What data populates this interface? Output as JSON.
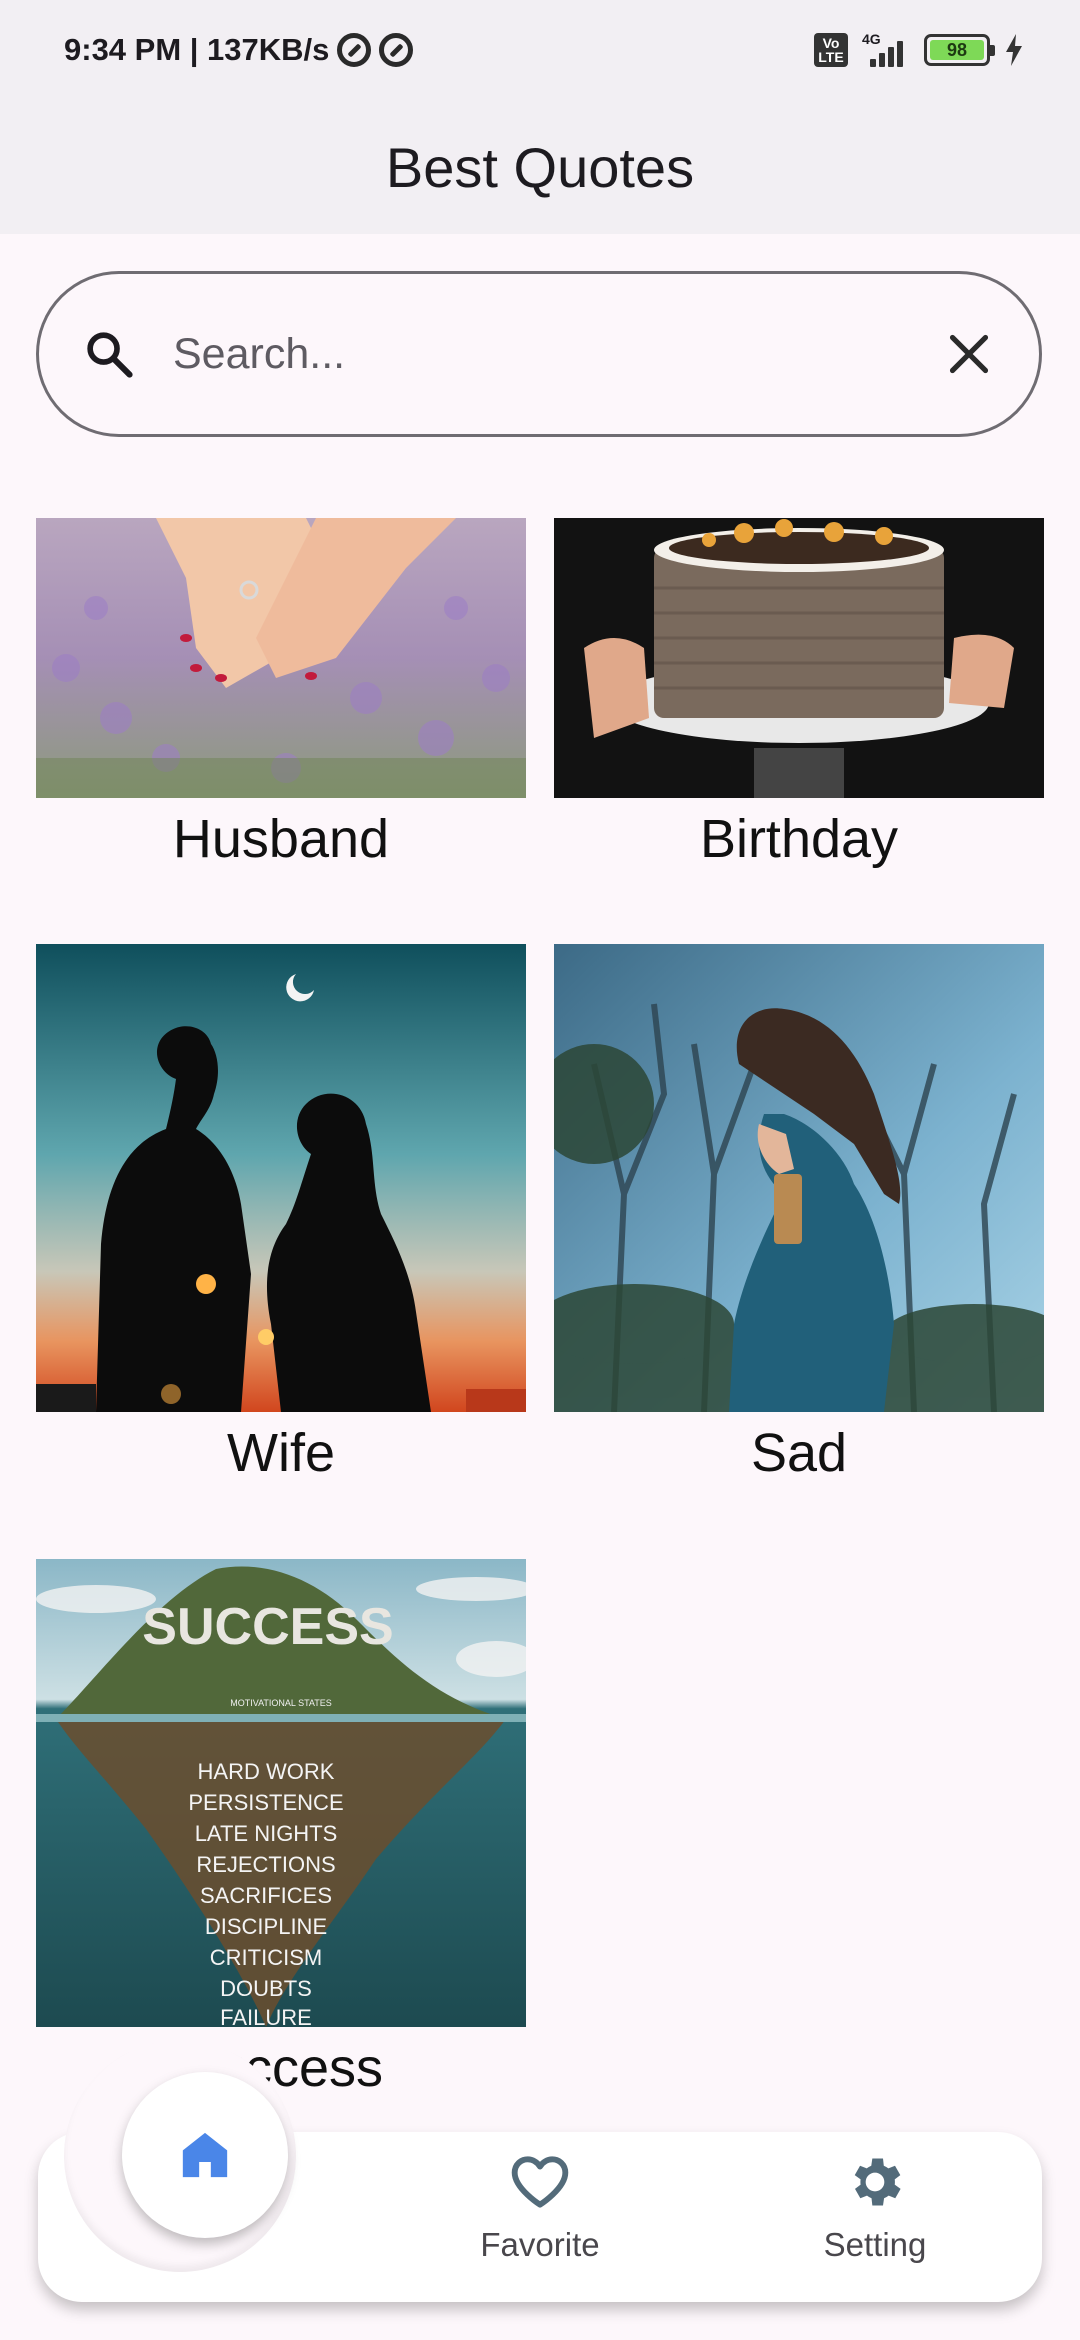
{
  "status_bar": {
    "time_speed": "9:34 PM | 137KB/s",
    "volte_label": "Vo LTE",
    "network_label": "4G",
    "battery_level": "98"
  },
  "app_bar": {
    "title": "Best Quotes"
  },
  "search": {
    "placeholder": "Search...",
    "value": ""
  },
  "categories": [
    {
      "label": "Husband"
    },
    {
      "label": "Birthday"
    },
    {
      "label": "Wife"
    },
    {
      "label": "Sad"
    },
    {
      "label": "Success"
    }
  ],
  "success_image_text": {
    "heading": "SUCCESS",
    "subheading": "MOTIVATIONAL STATES",
    "words": [
      "HARD WORK",
      "PERSISTENCE",
      "LATE NIGHTS",
      "REJECTIONS",
      "SACRIFICES",
      "DISCIPLINE",
      "CRITICISM",
      "DOUBTS",
      "FAILURE"
    ]
  },
  "bottom_nav": {
    "items": [
      {
        "label": "",
        "icon": "home-icon"
      },
      {
        "label": "Favorite",
        "icon": "heart-icon"
      },
      {
        "label": "Setting",
        "icon": "gear-icon"
      }
    ],
    "active_color": "#4a86e8",
    "inactive_color": "#536b7a"
  }
}
